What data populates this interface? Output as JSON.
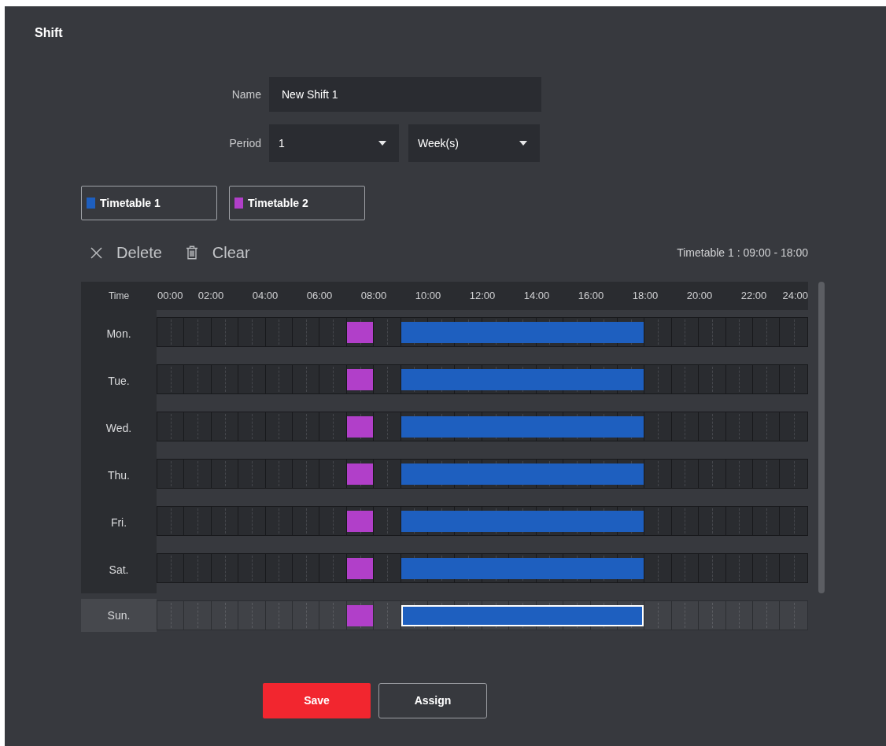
{
  "title": "Shift",
  "form": {
    "name": {
      "label": "Name",
      "value": "New Shift 1"
    },
    "period": {
      "label": "Period",
      "selects": [
        {
          "value": "1"
        },
        {
          "value": "Week(s)"
        }
      ]
    }
  },
  "timetables": [
    {
      "label": "Timetable 1",
      "color": "#1e5fbf"
    },
    {
      "label": "Timetable 2",
      "color": "#b13fc9"
    }
  ],
  "toolbar": {
    "actions": [
      {
        "kind": "delete",
        "label": "Delete"
      },
      {
        "kind": "clear",
        "label": "Clear"
      }
    ],
    "info": "Timetable 1 : 09:00 - 18:00"
  },
  "schedule": {
    "corner": "Time",
    "ticks": [
      "00:00",
      "02:00",
      "04:00",
      "06:00",
      "08:00",
      "10:00",
      "12:00",
      "14:00",
      "16:00",
      "18:00",
      "20:00",
      "22:00",
      "24:00"
    ],
    "days": [
      {
        "label": "Mon.",
        "selected": false,
        "hours": [
          {
            "selected": false
          },
          {
            "selected": false
          },
          {
            "selected": false
          },
          {
            "selected": false
          },
          {
            "selected": false
          },
          {
            "selected": false
          },
          {
            "selected": false
          },
          {
            "color": "#b13fc9",
            "selected": false
          },
          {
            "selected": false
          },
          {
            "color": "#1e5fbf",
            "selected": false
          },
          {
            "color": "#1e5fbf",
            "selected": false
          },
          {
            "color": "#1e5fbf",
            "selected": false
          },
          {
            "color": "#1e5fbf",
            "selected": false
          },
          {
            "color": "#1e5fbf",
            "selected": false
          },
          {
            "color": "#1e5fbf",
            "selected": false
          },
          {
            "color": "#1e5fbf",
            "selected": false
          },
          {
            "color": "#1e5fbf",
            "selected": false
          },
          {
            "color": "#1e5fbf",
            "selected": false
          },
          {
            "selected": false
          },
          {
            "selected": false
          },
          {
            "selected": false
          },
          {
            "selected": false
          },
          {
            "selected": false
          },
          {
            "selected": false
          }
        ]
      },
      {
        "label": "Tue.",
        "selected": false,
        "hours": [
          {
            "selected": false
          },
          {
            "selected": false
          },
          {
            "selected": false
          },
          {
            "selected": false
          },
          {
            "selected": false
          },
          {
            "selected": false
          },
          {
            "selected": false
          },
          {
            "color": "#b13fc9",
            "selected": false
          },
          {
            "selected": false
          },
          {
            "color": "#1e5fbf",
            "selected": false
          },
          {
            "color": "#1e5fbf",
            "selected": false
          },
          {
            "color": "#1e5fbf",
            "selected": false
          },
          {
            "color": "#1e5fbf",
            "selected": false
          },
          {
            "color": "#1e5fbf",
            "selected": false
          },
          {
            "color": "#1e5fbf",
            "selected": false
          },
          {
            "color": "#1e5fbf",
            "selected": false
          },
          {
            "color": "#1e5fbf",
            "selected": false
          },
          {
            "color": "#1e5fbf",
            "selected": false
          },
          {
            "selected": false
          },
          {
            "selected": false
          },
          {
            "selected": false
          },
          {
            "selected": false
          },
          {
            "selected": false
          },
          {
            "selected": false
          }
        ]
      },
      {
        "label": "Wed.",
        "selected": false,
        "hours": [
          {
            "selected": false
          },
          {
            "selected": false
          },
          {
            "selected": false
          },
          {
            "selected": false
          },
          {
            "selected": false
          },
          {
            "selected": false
          },
          {
            "selected": false
          },
          {
            "color": "#b13fc9",
            "selected": false
          },
          {
            "selected": false
          },
          {
            "color": "#1e5fbf",
            "selected": false
          },
          {
            "color": "#1e5fbf",
            "selected": false
          },
          {
            "color": "#1e5fbf",
            "selected": false
          },
          {
            "color": "#1e5fbf",
            "selected": false
          },
          {
            "color": "#1e5fbf",
            "selected": false
          },
          {
            "color": "#1e5fbf",
            "selected": false
          },
          {
            "color": "#1e5fbf",
            "selected": false
          },
          {
            "color": "#1e5fbf",
            "selected": false
          },
          {
            "color": "#1e5fbf",
            "selected": false
          },
          {
            "selected": false
          },
          {
            "selected": false
          },
          {
            "selected": false
          },
          {
            "selected": false
          },
          {
            "selected": false
          },
          {
            "selected": false
          }
        ]
      },
      {
        "label": "Thu.",
        "selected": false,
        "hours": [
          {
            "selected": false
          },
          {
            "selected": false
          },
          {
            "selected": false
          },
          {
            "selected": false
          },
          {
            "selected": false
          },
          {
            "selected": false
          },
          {
            "selected": false
          },
          {
            "color": "#b13fc9",
            "selected": false
          },
          {
            "selected": false
          },
          {
            "color": "#1e5fbf",
            "selected": false
          },
          {
            "color": "#1e5fbf",
            "selected": false
          },
          {
            "color": "#1e5fbf",
            "selected": false
          },
          {
            "color": "#1e5fbf",
            "selected": false
          },
          {
            "color": "#1e5fbf",
            "selected": false
          },
          {
            "color": "#1e5fbf",
            "selected": false
          },
          {
            "color": "#1e5fbf",
            "selected": false
          },
          {
            "color": "#1e5fbf",
            "selected": false
          },
          {
            "color": "#1e5fbf",
            "selected": false
          },
          {
            "selected": false
          },
          {
            "selected": false
          },
          {
            "selected": false
          },
          {
            "selected": false
          },
          {
            "selected": false
          },
          {
            "selected": false
          }
        ]
      },
      {
        "label": "Fri.",
        "selected": false,
        "hours": [
          {
            "selected": false
          },
          {
            "selected": false
          },
          {
            "selected": false
          },
          {
            "selected": false
          },
          {
            "selected": false
          },
          {
            "selected": false
          },
          {
            "selected": false
          },
          {
            "color": "#b13fc9",
            "selected": false
          },
          {
            "selected": false
          },
          {
            "color": "#1e5fbf",
            "selected": false
          },
          {
            "color": "#1e5fbf",
            "selected": false
          },
          {
            "color": "#1e5fbf",
            "selected": false
          },
          {
            "color": "#1e5fbf",
            "selected": false
          },
          {
            "color": "#1e5fbf",
            "selected": false
          },
          {
            "color": "#1e5fbf",
            "selected": false
          },
          {
            "color": "#1e5fbf",
            "selected": false
          },
          {
            "color": "#1e5fbf",
            "selected": false
          },
          {
            "color": "#1e5fbf",
            "selected": false
          },
          {
            "selected": false
          },
          {
            "selected": false
          },
          {
            "selected": false
          },
          {
            "selected": false
          },
          {
            "selected": false
          },
          {
            "selected": false
          }
        ]
      },
      {
        "label": "Sat.",
        "selected": false,
        "hours": [
          {
            "selected": false
          },
          {
            "selected": false
          },
          {
            "selected": false
          },
          {
            "selected": false
          },
          {
            "selected": false
          },
          {
            "selected": false
          },
          {
            "selected": false
          },
          {
            "color": "#b13fc9",
            "selected": false
          },
          {
            "selected": false
          },
          {
            "color": "#1e5fbf",
            "selected": false
          },
          {
            "color": "#1e5fbf",
            "selected": false
          },
          {
            "color": "#1e5fbf",
            "selected": false
          },
          {
            "color": "#1e5fbf",
            "selected": false
          },
          {
            "color": "#1e5fbf",
            "selected": false
          },
          {
            "color": "#1e5fbf",
            "selected": false
          },
          {
            "color": "#1e5fbf",
            "selected": false
          },
          {
            "color": "#1e5fbf",
            "selected": false
          },
          {
            "color": "#1e5fbf",
            "selected": false
          },
          {
            "selected": false
          },
          {
            "selected": false
          },
          {
            "selected": false
          },
          {
            "selected": false
          },
          {
            "selected": false
          },
          {
            "selected": false
          }
        ]
      },
      {
        "label": "Sun.",
        "selected": true,
        "hours": [
          {
            "selected": false
          },
          {
            "selected": false
          },
          {
            "selected": false
          },
          {
            "selected": false
          },
          {
            "selected": false
          },
          {
            "selected": false
          },
          {
            "selected": false
          },
          {
            "color": "#b13fc9",
            "selected": false
          },
          {
            "selected": false
          },
          {
            "color": "#1e5fbf",
            "selected": true
          },
          {
            "color": "#1e5fbf",
            "selected": true
          },
          {
            "color": "#1e5fbf",
            "selected": true
          },
          {
            "color": "#1e5fbf",
            "selected": true
          },
          {
            "color": "#1e5fbf",
            "selected": true
          },
          {
            "color": "#1e5fbf",
            "selected": true
          },
          {
            "color": "#1e5fbf",
            "selected": true
          },
          {
            "color": "#1e5fbf",
            "selected": true
          },
          {
            "color": "#1e5fbf",
            "selected": true
          },
          {
            "selected": false
          },
          {
            "selected": false
          },
          {
            "selected": false
          },
          {
            "selected": false
          },
          {
            "selected": false
          },
          {
            "selected": false
          }
        ]
      }
    ]
  },
  "buttons": [
    {
      "kind": "primary",
      "label": "Save"
    },
    {
      "kind": "secondary",
      "label": "Assign"
    }
  ]
}
